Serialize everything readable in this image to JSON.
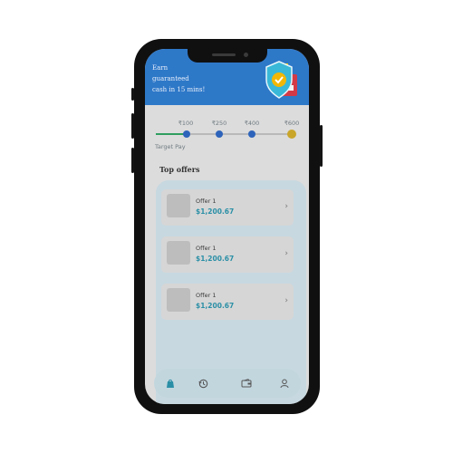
{
  "banner": {
    "lines": [
      "Earn",
      "guaranteed",
      "cash in 15 mins!"
    ]
  },
  "progress": {
    "milestones": [
      "₹100",
      "₹250",
      "₹400",
      "₹600"
    ],
    "target_label": "Target Pay",
    "colors": {
      "done": "#2f9e5f",
      "dot": "#2d63ba",
      "final_dot": "#c9a52a"
    }
  },
  "offers": {
    "title": "Top offers",
    "items": [
      {
        "title": "Offer 1",
        "price": "$1,200.67"
      },
      {
        "title": "Offer 1",
        "price": "$1,200.67"
      },
      {
        "title": "Offer 1",
        "price": "$1,200.67"
      }
    ]
  },
  "nav": {
    "items": [
      {
        "icon": "bag-icon",
        "active": true
      },
      {
        "icon": "history-icon",
        "active": false
      },
      {
        "icon": "wallet-icon",
        "active": false
      },
      {
        "icon": "profile-icon",
        "active": false
      }
    ],
    "colors": {
      "active": "#2a8fa6",
      "inactive": "#555555"
    }
  },
  "theme": {
    "accent": "#2e78c8",
    "price": "#2a8fa6"
  }
}
